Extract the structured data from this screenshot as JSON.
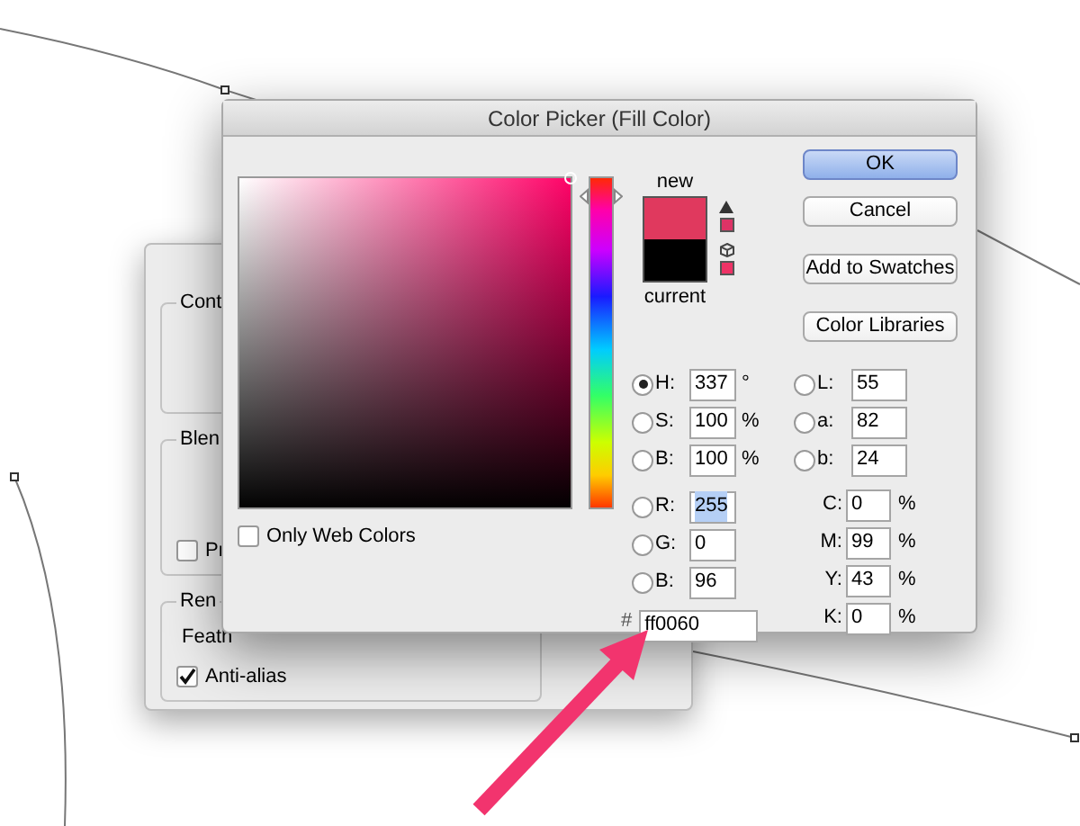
{
  "window": {
    "title": "Color Picker (Fill Color)"
  },
  "back_dialog": {
    "groups": [
      "Cont",
      "Blen",
      "Ren"
    ],
    "preview": {
      "label": "Pr",
      "checked": false
    },
    "feather_label": "Feath",
    "anti_alias": {
      "label": "Anti-alias",
      "checked": true
    }
  },
  "hue_slider": {
    "level": 0.94
  },
  "swatch": {
    "new_label": "new",
    "current_label": "current"
  },
  "buttons": [
    {
      "label": "OK",
      "default": true
    },
    {
      "label": "Cancel",
      "default": false
    },
    {
      "label": "Add to Swatches",
      "default": false
    },
    {
      "label": "Color Libraries",
      "default": false
    }
  ],
  "fields_hsb_rgb": [
    {
      "label": "H:",
      "value": "337",
      "unit": "°",
      "selected": true,
      "highlighted": false
    },
    {
      "label": "S:",
      "value": "100",
      "unit": "%",
      "selected": false,
      "highlighted": false
    },
    {
      "label": "B:",
      "value": "100",
      "unit": "%",
      "selected": false,
      "highlighted": false
    },
    {
      "label": "R:",
      "value": "255",
      "selected": false,
      "highlighted": true
    },
    {
      "label": "G:",
      "value": "0",
      "selected": false,
      "highlighted": false
    },
    {
      "label": "B:",
      "value": "96",
      "selected": false,
      "highlighted": false
    }
  ],
  "fields_lab": [
    {
      "label": "L:",
      "value": "55",
      "selected": false
    },
    {
      "label": "a:",
      "value": "82",
      "selected": false
    },
    {
      "label": "b:",
      "value": "24",
      "selected": false
    }
  ],
  "fields_cmyk": [
    {
      "label": "C:",
      "value": "0",
      "unit": "%"
    },
    {
      "label": "M:",
      "value": "99",
      "unit": "%"
    },
    {
      "label": "Y:",
      "value": "43",
      "unit": "%"
    },
    {
      "label": "K:",
      "value": "0",
      "unit": "%"
    }
  ],
  "hex": {
    "label": "#",
    "value": "ff0060"
  },
  "only_web_colors": {
    "label": "Only Web Colors",
    "checked": false
  }
}
